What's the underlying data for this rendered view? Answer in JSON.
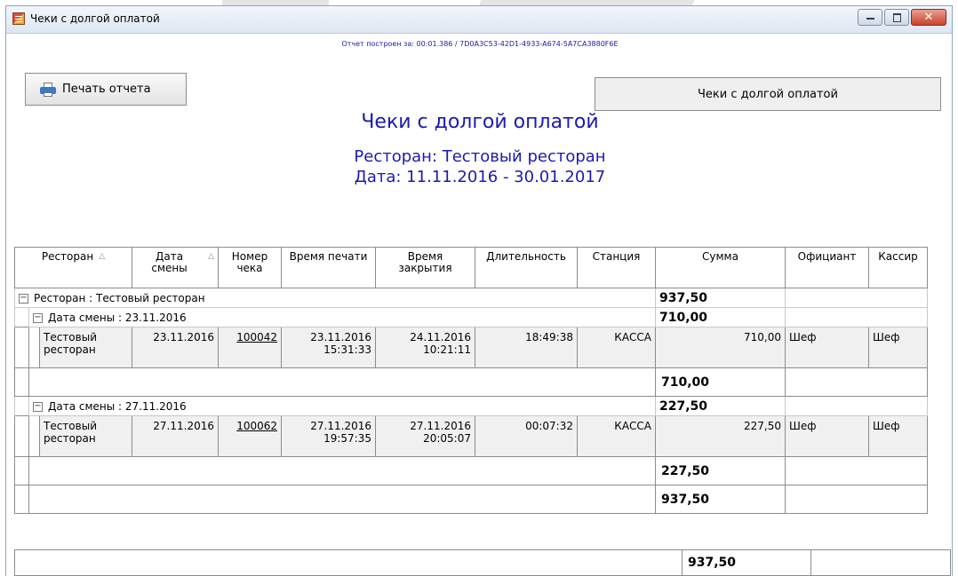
{
  "window": {
    "title": "Чеки с долгой оплатой",
    "close_glyph": "✕"
  },
  "info_text": "Отчет построен за: 00:01.386 / 7D0A3C53-42D1-4933-A674-5A7CA3880F6E",
  "buttons": {
    "print": "Печать отчета",
    "report": "Чеки с долгой оплатой"
  },
  "report": {
    "title": "Чеки с долгой оплатой",
    "restaurant_line": "Ресторан: Тестовый ресторан",
    "date_line": "Дата: 11.11.2016 - 30.01.2017"
  },
  "columns": {
    "restaurant": "Ресторан",
    "shift_date": "Дата смены",
    "check_no": "Номер чека",
    "print_time": "Время печати",
    "close_time": "Время закрытия",
    "duration": "Длительность",
    "station": "Станция",
    "sum": "Сумма",
    "waiter": "Официант",
    "cashier": "Кассир"
  },
  "group": {
    "label": "Ресторан : Тестовый ресторан",
    "total": "937,50",
    "expander": "−",
    "subgroups": [
      {
        "label": "Дата смены : 23.11.2016",
        "total": "710,00",
        "row": {
          "restaurant_1": "Тестовый",
          "restaurant_2": "ресторан",
          "shift_date": "23.11.2016",
          "check_no": "100042",
          "print_date": "23.11.2016",
          "print_time": "15:31:33",
          "close_date": "24.11.2016",
          "close_time": "10:21:11",
          "duration": "18:49:38",
          "station": "КАССА",
          "sum": "710,00",
          "waiter": "Шеф",
          "cashier": "Шеф"
        },
        "subtotal": "710,00"
      },
      {
        "label": "Дата смены : 27.11.2016",
        "total": "227,50",
        "row": {
          "restaurant_1": "Тестовый",
          "restaurant_2": "ресторан",
          "shift_date": "27.11.2016",
          "check_no": "100062",
          "print_date": "27.11.2016",
          "print_time": "19:57:35",
          "close_date": "27.11.2016",
          "close_time": "20:05:07",
          "duration": "00:07:32",
          "station": "КАССА",
          "sum": "227,50",
          "waiter": "Шеф",
          "cashier": "Шеф"
        },
        "subtotal": "227,50"
      }
    ],
    "group_total": "937,50"
  },
  "grand_total": "937,50"
}
